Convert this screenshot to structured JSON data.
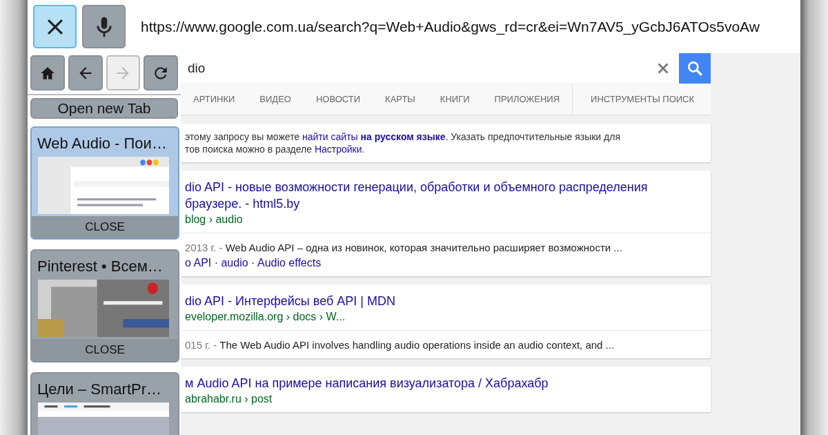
{
  "top_bar": {
    "close_button": {
      "active": true
    },
    "url": "https://www.google.com.ua/search?q=Web+Audio&gws_rd=cr&ei=Wn7AV5_yGcbJ6ATOs5voAw"
  },
  "nav_buttons": [
    {
      "kind": "home",
      "disabled": false
    },
    {
      "kind": "back",
      "disabled": false
    },
    {
      "kind": "forward",
      "disabled": true
    },
    {
      "kind": "refresh",
      "disabled": false
    }
  ],
  "new_tab_button": "Open new Tab",
  "tabs": [
    {
      "title": "Web Audio - Пои…",
      "selected": true,
      "close_label": "CLOSE"
    },
    {
      "title": "Pinterest • Всем…",
      "selected": false,
      "close_label": "CLOSE"
    },
    {
      "title": "Цели – SmartPr…",
      "selected": false
    }
  ],
  "search": {
    "value": "dio"
  },
  "search_tabs": [
    {
      "kind": "category",
      "label": "АРТИНКИ"
    },
    {
      "kind": "category",
      "label": "ВИДЕО"
    },
    {
      "kind": "category",
      "label": "НОВОСТИ"
    },
    {
      "kind": "category",
      "label": "КАРТЫ"
    },
    {
      "kind": "category",
      "label": "КНИГИ"
    },
    {
      "kind": "category",
      "label": "ПРИЛОЖЕНИЯ"
    },
    {
      "kind": "tools",
      "label": "ИНСТРУМЕНТЫ ПОИСК"
    }
  ],
  "notice": {
    "lines": [
      [
        {
          "kind": "plain",
          "text": "этому запросу вы можете "
        },
        {
          "kind": "link",
          "text": "найти сайты"
        },
        {
          "kind": "bold-link",
          "text": "на русском языке"
        },
        {
          "kind": "plain",
          "text": ". Указать предпочтительные языки для"
        }
      ],
      [
        {
          "kind": "plain",
          "text": "тов поиска можно в разделе "
        },
        {
          "kind": "link",
          "text": "Настройки"
        },
        {
          "kind": "plain",
          "text": "."
        }
      ]
    ]
  },
  "results": [
    {
      "title_lines": [
        "dio API - новые возможности генерации, обработки и объемного распределения",
        "браузере. - html5.by"
      ],
      "url": "blog › audio",
      "date": "2013 г. - ",
      "snippet": "Web Audio API – одна из новинок, которая значительно расширяет возможности ...",
      "sublinks": "o API · audio · Audio effects"
    },
    {
      "title_lines": [
        "dio API - Интерфейсы веб API | MDN"
      ],
      "url": "eveloper.mozilla.org › docs › W...",
      "date": "015 г. - ",
      "snippet": "The Web Audio API involves handling audio operations inside an audio context, and ..."
    },
    {
      "title_lines": [
        "м Audio API на примере написания визуализатора / Хабрахабр"
      ],
      "url": "abrahabr.ru › post"
    }
  ]
}
